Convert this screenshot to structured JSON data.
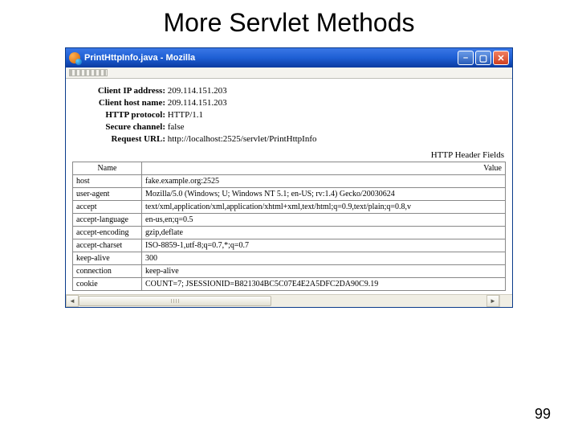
{
  "slide": {
    "title": "More Servlet Methods",
    "page_number": "99"
  },
  "window": {
    "title": "PrintHttpInfo.java - Mozilla"
  },
  "info": {
    "ip_label": "Client IP address:",
    "ip_value": "209.114.151.203",
    "host_label": "Client host name:",
    "host_value": "209.114.151.203",
    "proto_label": "HTTP protocol:",
    "proto_value": "HTTP/1.1",
    "secure_label": "Secure channel:",
    "secure_value": "false",
    "url_label": "Request URL:",
    "url_value": "http://localhost:2525/servlet/PrintHttpInfo"
  },
  "table": {
    "caption": "HTTP Header Fields",
    "col_name": "Name",
    "col_value": "Value",
    "rows": [
      {
        "name": "host",
        "value": "fake.example.org:2525"
      },
      {
        "name": "user-agent",
        "value": "Mozilla/5.0 (Windows; U; Windows NT 5.1; en-US; rv:1.4) Gecko/20030624"
      },
      {
        "name": "accept",
        "value": "text/xml,application/xml,application/xhtml+xml,text/html;q=0.9,text/plain;q=0.8,v"
      },
      {
        "name": "accept-language",
        "value": "en-us,en;q=0.5"
      },
      {
        "name": "accept-encoding",
        "value": "gzip,deflate"
      },
      {
        "name": "accept-charset",
        "value": "ISO-8859-1,utf-8;q=0.7,*;q=0.7"
      },
      {
        "name": "keep-alive",
        "value": "300"
      },
      {
        "name": "connection",
        "value": "keep-alive"
      },
      {
        "name": "cookie",
        "value": "COUNT=7; JSESSIONID=B821304BC5C07E4E2A5DFC2DA90C9.19"
      }
    ]
  }
}
